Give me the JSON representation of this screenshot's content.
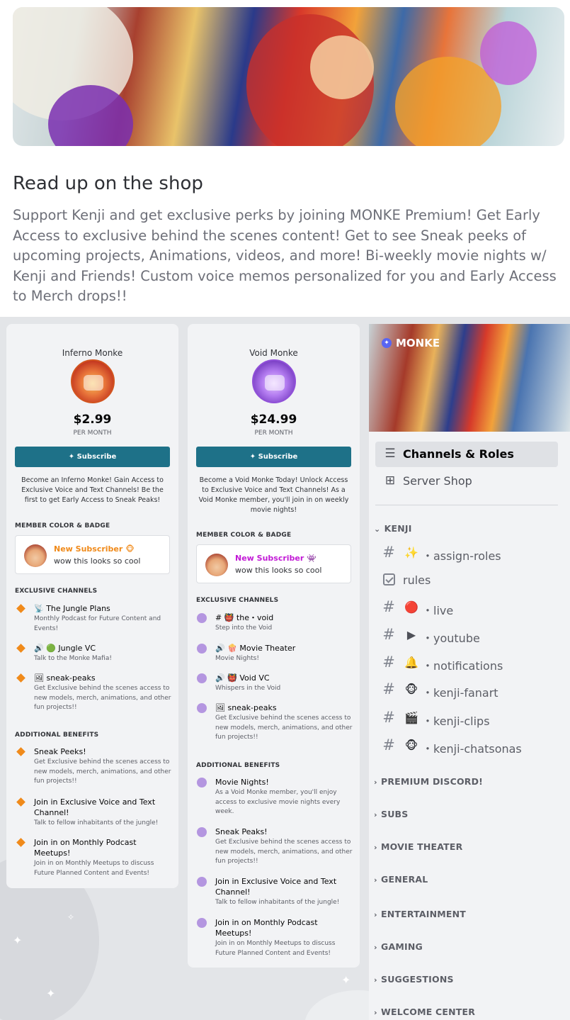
{
  "shop": {
    "title": "Read up on the shop",
    "description": "Support Kenji and get exclusive perks by joining MONKE Premium! Get Early Access to exclusive behind the scenes content! Get to see Sneak peeks of upcoming projects, Animations, videos, and more! Bi-weekly movie nights w/ Kenji and Friends! Custom voice memos personalized for you and Early Access to Merch drops!!"
  },
  "tiers": [
    {
      "name": "Inferno Monke",
      "price": "$2.99",
      "period": "PER MONTH",
      "subscribe_label": "✦ Subscribe",
      "description": "Become an Inferno Monke! Gain Access to Exclusive Voice and Text Channels! Be the first to get Early Access to Sneak Peaks!",
      "member_header": "MEMBER COLOR & BADGE",
      "badge_name": "New Subscriber",
      "badge_emoji": "🐵",
      "badge_color": "#f08a1a",
      "badge_message": "wow this looks so cool",
      "channels_header": "EXCLUSIVE CHANNELS",
      "channels": [
        {
          "icon": "📡",
          "name": "The Jungle Plans",
          "desc": "Monthly Podcast for Future Content and Events!"
        },
        {
          "icon": "🔊 🟢",
          "name": "Jungle VC",
          "desc": "Talk to the Monke Mafia!"
        },
        {
          "icon": "🖼",
          "name": "sneak-peaks",
          "desc": "Get Exclusive behind the scenes access to new models, merch, animations, and other fun projects!!"
        }
      ],
      "benefits_header": "ADDITIONAL BENEFITS",
      "benefits": [
        {
          "name": "Sneak Peeks!",
          "desc": "Get Exclusive behind the scenes access to new models, merch, animations, and other fun projects!!"
        },
        {
          "name": "Join in Exclusive Voice and Text Channel!",
          "desc": "Talk to fellow inhabitants of the jungle!"
        },
        {
          "name": "Join in on Monthly Podcast Meetups!",
          "desc": "Join in on Monthly Meetups to discuss Future Planned Content and Events!"
        }
      ]
    },
    {
      "name": "Void Monke",
      "price": "$24.99",
      "period": "PER MONTH",
      "subscribe_label": "✦ Subscribe",
      "description": "Become a Void Monke Today! Unlock Access to Exclusive Voice and Text Channels! As a Void Monke member, you'll join in on weekly movie nights!",
      "member_header": "MEMBER COLOR & BADGE",
      "badge_name": "New Subscriber",
      "badge_emoji": "👾",
      "badge_color": "#c21ad6",
      "badge_message": "wow this looks so cool",
      "channels_header": "EXCLUSIVE CHANNELS",
      "channels": [
        {
          "icon": "# 👹",
          "name": "the・void",
          "desc": "Step into the Void"
        },
        {
          "icon": "🔊 🍿",
          "name": "Movie Theater",
          "desc": "Movie Nights!"
        },
        {
          "icon": "🔊 👹",
          "name": "Void VC",
          "desc": "Whispers in the Void"
        },
        {
          "icon": "🖼",
          "name": "sneak-peaks",
          "desc": "Get Exclusive behind the scenes access to new models, merch, animations, and other fun projects!!"
        }
      ],
      "benefits_header": "ADDITIONAL BENEFITS",
      "benefits": [
        {
          "name": "Movie Nights!",
          "desc": "As a Void Monke member, you'll enjoy access to exclusive movie nights every week."
        },
        {
          "name": "Sneak Peaks!",
          "desc": "Get Exclusive behind the scenes access to new models, merch, animations, and other fun projects!!"
        },
        {
          "name": "Join in Exclusive Voice and Text Channel!",
          "desc": "Talk to fellow inhabitants of the jungle!"
        },
        {
          "name": "Join in on Monthly Podcast Meetups!",
          "desc": "Join in on Monthly Meetups to discuss Future Planned Content and Events!"
        }
      ]
    }
  ],
  "sidebar": {
    "server_name": "MONKE",
    "items": [
      {
        "icon": "list-search-icon",
        "label": "Channels & Roles"
      },
      {
        "icon": "shop-icon",
        "label": "Server Shop"
      }
    ],
    "open_category": "KENJI",
    "channels": [
      {
        "emoji": "✨",
        "label": "・assign-roles"
      },
      {
        "emoji": "",
        "label": "rules"
      },
      {
        "emoji": "🔴",
        "label": "・live"
      },
      {
        "emoji": "▶",
        "label": "・youtube"
      },
      {
        "emoji": "🔔",
        "label": "・notifications"
      },
      {
        "emoji": "🐵",
        "label": "・kenji-fanart"
      },
      {
        "emoji": "🎬",
        "label": "・kenji-clips"
      },
      {
        "emoji": "🐵",
        "label": "・kenji-chatsonas"
      }
    ],
    "categories": [
      "PREMIUM DISCORD!",
      "SUBS",
      "MOVIE THEATER",
      "GENERAL",
      "ENTERTAINMENT",
      "GAMING",
      "SUGGESTIONS",
      "WELCOME CENTER"
    ]
  }
}
